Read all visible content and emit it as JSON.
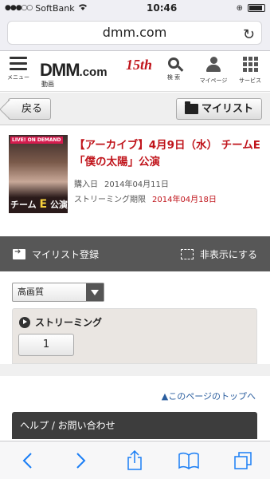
{
  "status": {
    "carrier": "SoftBank",
    "signal_dots": "●●●○○",
    "time": "10:46"
  },
  "browser": {
    "url": "dmm.com"
  },
  "header": {
    "menu_label": "メニュー",
    "logo_main": "DMM",
    "logo_com": ".com",
    "logo_anniv": "15th",
    "logo_sub": "動画",
    "search_label": "検 索",
    "mypage_label": "マイページ",
    "services_label": "サービス"
  },
  "toolbar": {
    "back_label": "戻る",
    "mylist_label": "マイリスト"
  },
  "product": {
    "thumb_badge": "LIVE! ON DEMAND",
    "thumb_team": "チーム",
    "thumb_team_letter": "E",
    "thumb_team_suffix": "公演",
    "title": "【アーカイブ】4月9日（水） チームE 「僕の太陽」公演",
    "purchase_label": "購入日",
    "purchase_date": "2014年04月11日",
    "stream_limit_label": "ストリーミング期限",
    "stream_limit_date": "2014年04月18日"
  },
  "actions": {
    "add_mylist": "マイリスト登録",
    "hide": "非表示にする"
  },
  "player": {
    "quality_selected": "高画質",
    "stream_heading": "ストリーミング",
    "part_button": "1"
  },
  "footer": {
    "page_top": "▲このページのトップへ",
    "help": "ヘルプ / お問い合わせ"
  },
  "colors": {
    "accent_red": "#c0141b",
    "link_blue": "#2a5d9e",
    "ios_blue": "#1a7ef5"
  }
}
